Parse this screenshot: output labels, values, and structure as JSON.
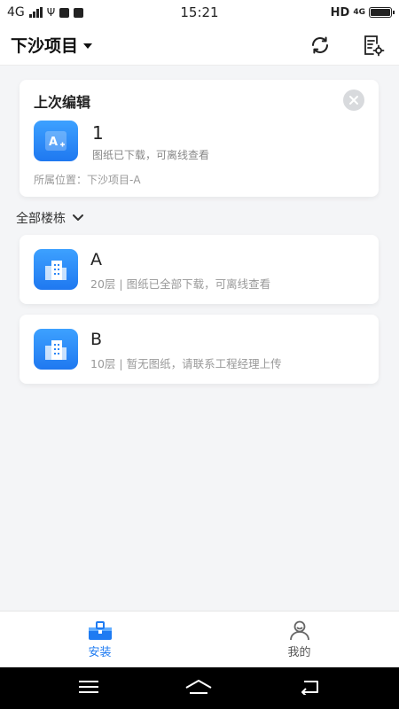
{
  "status_bar": {
    "network": "4G",
    "time": "15:21",
    "hd": "HD",
    "net_right": "4G"
  },
  "header": {
    "project_name": "下沙项目"
  },
  "last_edit": {
    "heading": "上次编辑",
    "drawing_name": "1",
    "drawing_status": "图纸已下载，可离线查看",
    "location": "所属位置：下沙项目-A",
    "icon_letter": "A"
  },
  "section": {
    "label": "全部楼栋"
  },
  "buildings": [
    {
      "name": "A",
      "status": "20层 | 图纸已全部下载，可离线查看"
    },
    {
      "name": "B",
      "status": "10层 | 暂无图纸，请联系工程经理上传"
    }
  ],
  "tabs": [
    {
      "label": "安装",
      "active": true
    },
    {
      "label": "我的",
      "active": false
    }
  ],
  "colors": {
    "accent": "#1e7bf2",
    "icon_gradient_top": "#3da1ff",
    "icon_gradient_bottom": "#1f78f0"
  }
}
